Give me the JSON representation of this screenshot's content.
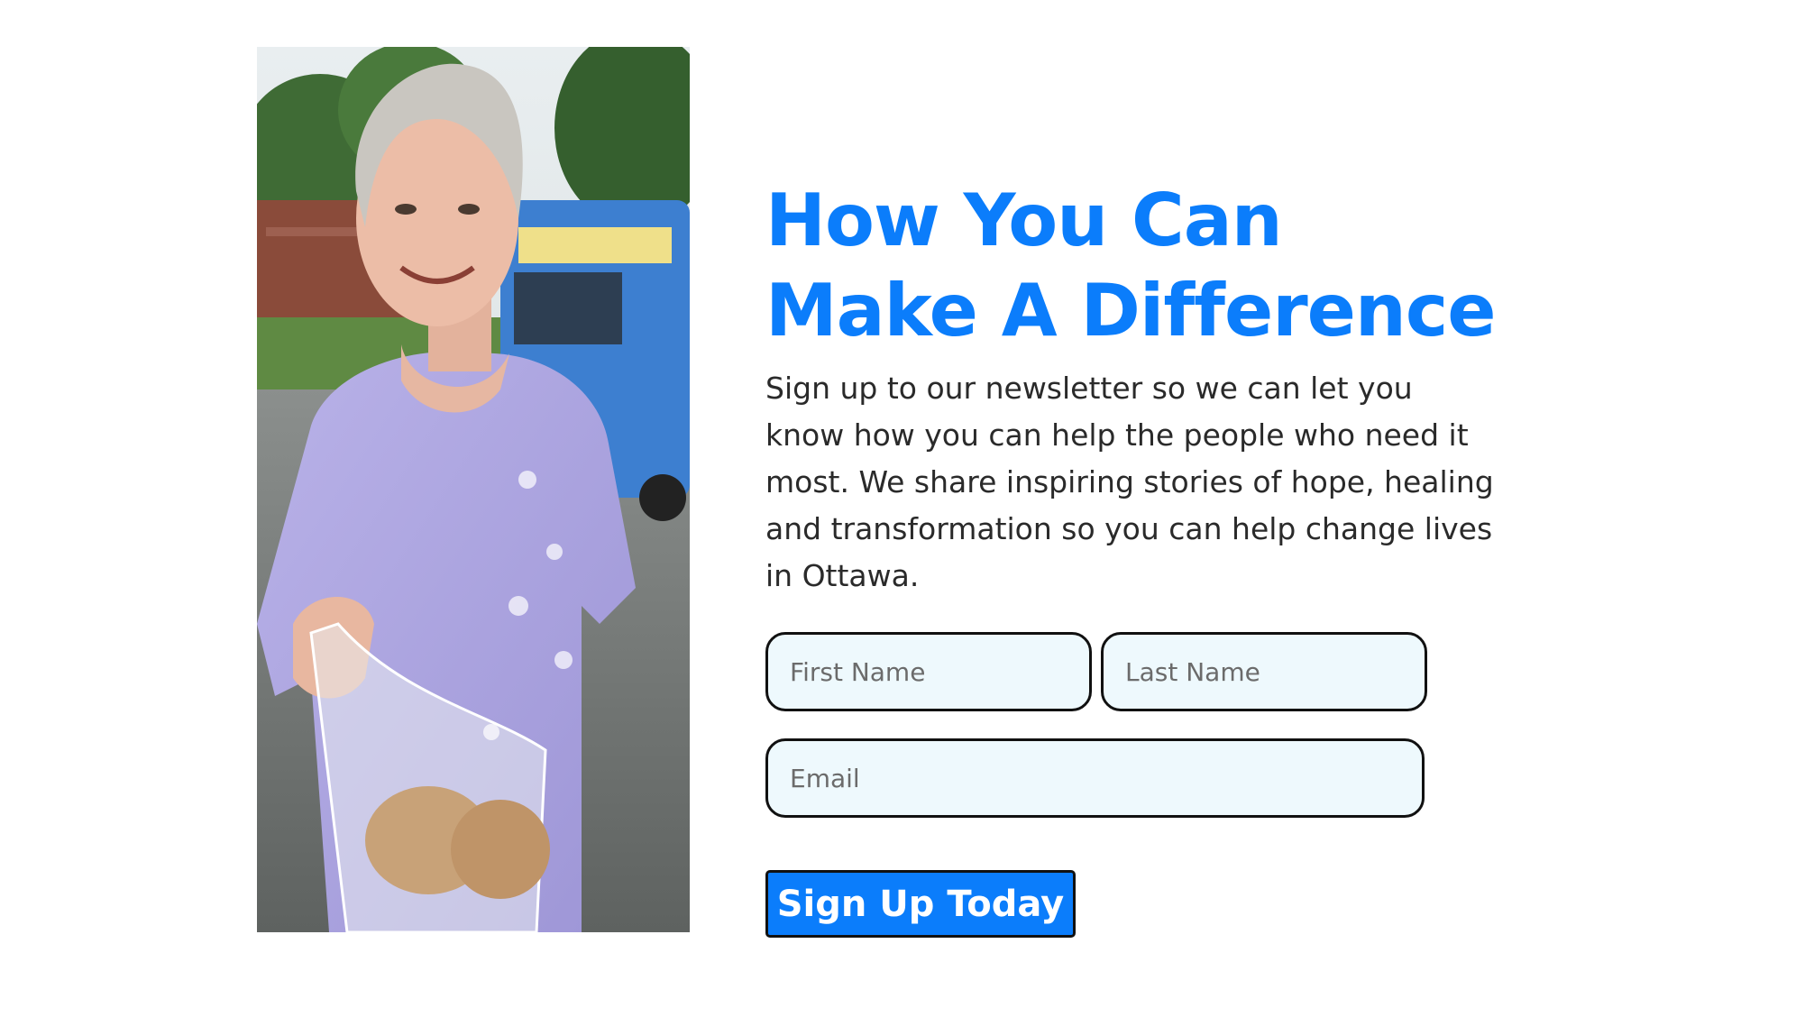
{
  "hero": {
    "image_alt": "Smiling woman holding a plastic bag of bread in front of a food truck",
    "heading": "How You Can Make A Difference",
    "description": "Sign up to our newsletter so we can let you know how you can help the people who need it most. We share inspiring stories of hope, healing and transformation so you can help change lives in Ottawa."
  },
  "form": {
    "first_name_placeholder": "First Name",
    "last_name_placeholder": "Last Name",
    "email_placeholder": "Email",
    "submit_label": "Sign Up Today"
  },
  "colors": {
    "accent": "#0b7dfb",
    "field_background": "#eef9fd",
    "border": "#111111"
  }
}
